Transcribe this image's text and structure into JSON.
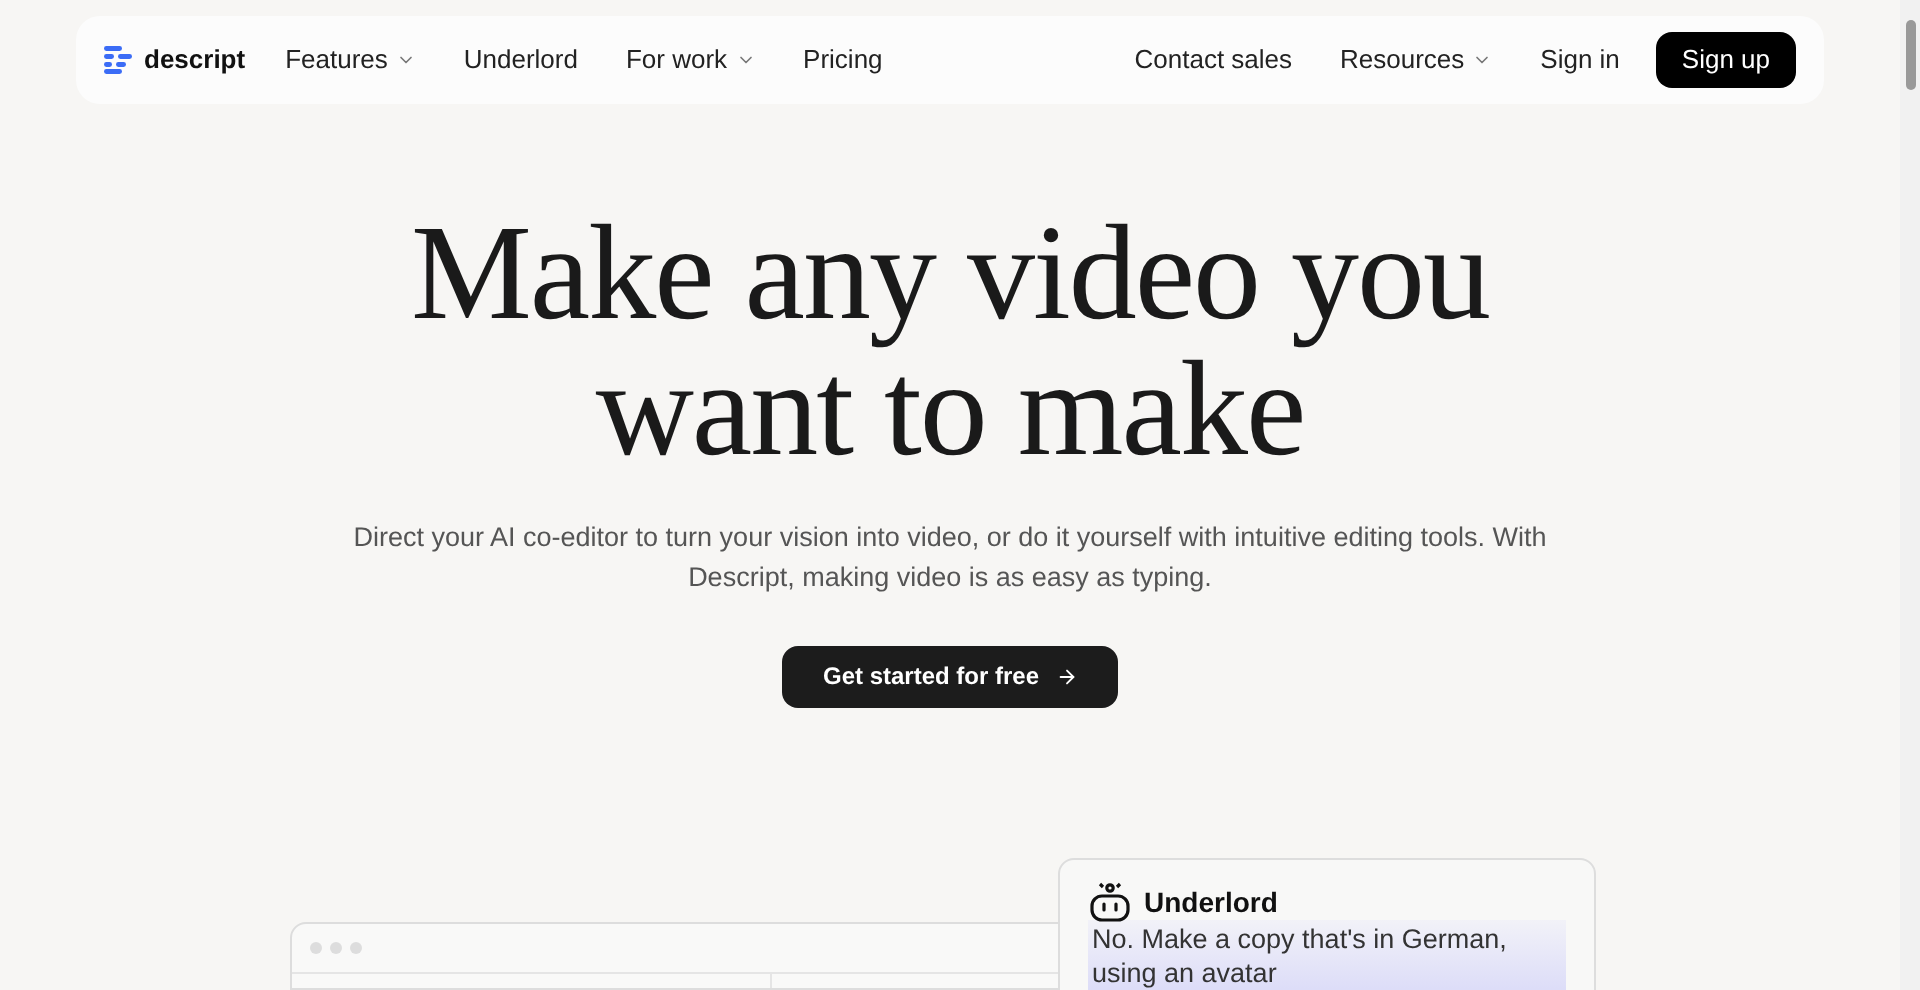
{
  "nav": {
    "logo": "descript",
    "links": [
      {
        "label": "Features",
        "dropdown": true
      },
      {
        "label": "Underlord",
        "dropdown": false
      },
      {
        "label": "For work",
        "dropdown": true
      },
      {
        "label": "Pricing",
        "dropdown": false
      }
    ],
    "right_links": [
      {
        "label": "Contact sales",
        "dropdown": false
      },
      {
        "label": "Resources",
        "dropdown": true
      },
      {
        "label": "Sign in",
        "dropdown": false
      }
    ],
    "cta": "Sign up"
  },
  "hero": {
    "title_lines": [
      "Make any video you",
      "want to make"
    ],
    "subtitle": "Direct your AI co-editor to turn your vision into video, or do it yourself with intuitive editing tools. With Descript, making video is as easy as typing.",
    "button": "Get started for free"
  },
  "chat_card": {
    "title": "Underlord",
    "message": "No. Make a copy that's in German, using an avatar"
  }
}
